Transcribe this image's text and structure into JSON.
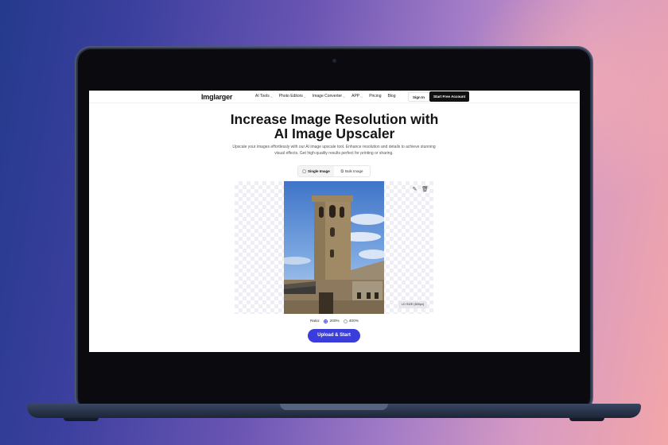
{
  "nav": {
    "logo": "Imglarger",
    "menu": [
      {
        "label": "AI Tools",
        "dropdown": true
      },
      {
        "label": "Photo Editors",
        "dropdown": true
      },
      {
        "label": "Image Converter",
        "dropdown": true
      },
      {
        "label": "APP",
        "dropdown": true
      },
      {
        "label": "Pricing",
        "dropdown": false
      },
      {
        "label": "Blog",
        "dropdown": false
      }
    ],
    "sign_in": "Sign In",
    "start_free": "Start Free Account"
  },
  "hero": {
    "title": "Increase Image Resolution with AI Image Upscaler",
    "subtitle": "Upscale your images effortlessly with our AI image upscale tool. Enhance resolution and details to achieve stunning visual effects. Get high-quality results perfect for printing or sharing."
  },
  "tabs": [
    {
      "label": "Single Image",
      "icon": "image-icon",
      "active": true
    },
    {
      "label": "Bulk Image",
      "icon": "images-icon",
      "active": false
    }
  ],
  "preview": {
    "size_badge": "LD SIZE (800px)",
    "edit_icon": "edit-icon",
    "trash_icon": "trash-icon"
  },
  "ratio": {
    "label": "Ratio:",
    "options": [
      {
        "label": "200%",
        "selected": true
      },
      {
        "label": "400%",
        "selected": false
      }
    ]
  },
  "upload_button": "Upload & Start",
  "colors": {
    "accent": "#3a3ddb",
    "dark_button": "#111111"
  }
}
